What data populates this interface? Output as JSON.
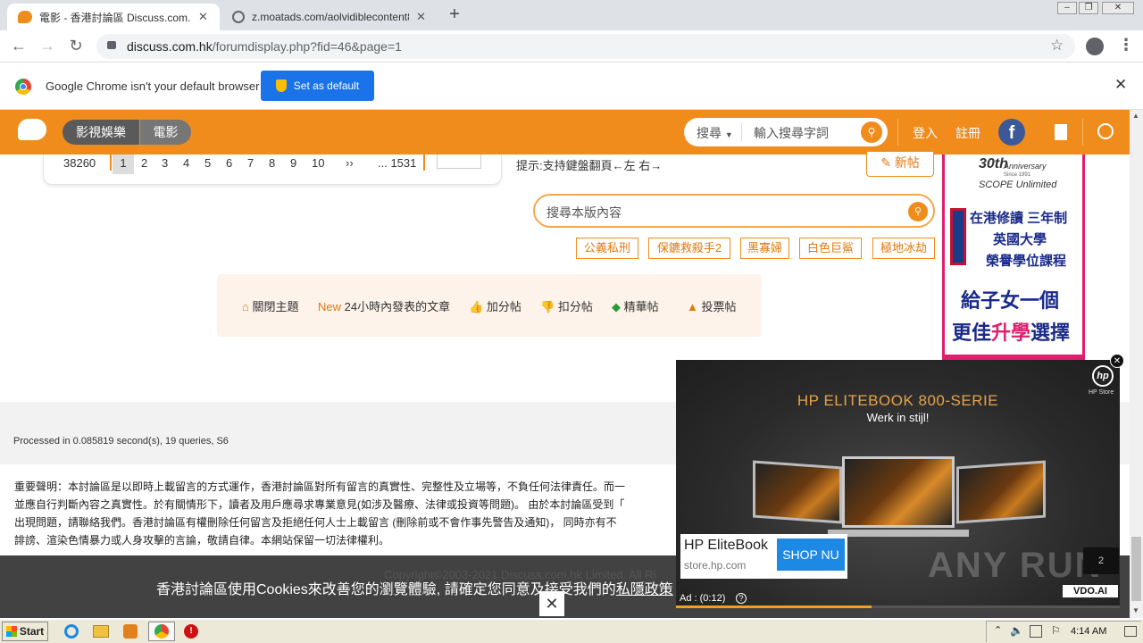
{
  "browser": {
    "tabs": [
      {
        "title": "電影 - 香港討論區 Discuss.com.hk -",
        "active": true
      },
      {
        "title": "z.moatads.com/aolvidiblecontent859",
        "active": false
      }
    ],
    "url_host": "discuss.com.hk",
    "url_path": "/forumdisplay.php?fid=46&page=1",
    "infobar_text": "Google Chrome isn't your default browser",
    "set_default_label": "Set as default"
  },
  "site": {
    "nav_tabs": [
      "影視娛樂",
      "電影"
    ],
    "search_scope": "搜尋",
    "search_placeholder": "輸入搜尋字詞",
    "login": "登入",
    "register": "註冊"
  },
  "pager": {
    "total": "38260",
    "pages": [
      "1",
      "2",
      "3",
      "4",
      "5",
      "6",
      "7",
      "8",
      "9",
      "10"
    ],
    "next": "››",
    "last": "... 1531",
    "current": "1"
  },
  "hint": "提示:支持鍵盤翻頁←左 右→",
  "new_post": "新帖",
  "board_search_placeholder": "搜尋本版內容",
  "tags": [
    "公義私刑",
    "保鑣救殺手2",
    "黑寡婦",
    "白色巨鯊",
    "極地冰劫"
  ],
  "actions": [
    {
      "label": "關閉主題",
      "prefix": ""
    },
    {
      "label": "24小時內發表的文章",
      "prefix": "New"
    },
    {
      "label": "加分帖",
      "prefix": ""
    },
    {
      "label": "扣分帖",
      "prefix": ""
    },
    {
      "label": "精華帖",
      "prefix": ""
    },
    {
      "label": "投票帖",
      "prefix": ""
    }
  ],
  "processed": "Processed in 0.085819 second(s), 19 queries, S6",
  "disclaimer": [
    "重要聲明：本討論區是以即時上載留言的方式運作，香港討論區對所有留言的真實性、完整性及立場等，不負任何法律責任。而一",
    "並應自行判斷內容之真實性。於有關情形下，讀者及用戶應尋求專業意見(如涉及醫療、法律或投資等問題)。 由於本討論區受到「",
    "出現問題，請聯絡我們。香港討論區有權刪除任何留言及拒絕任何人士上載留言 (刪除前或不會作事先警告及通知)， 同時亦有不",
    "誹謗、渲染色情暴力或人身攻擊的言論，敬請自律。本網站保留一切法律權利。"
  ],
  "copyright": "Copyright©2003-2021 Discuss.com.hk Limited. All Ri",
  "cookie": {
    "text": "香港討論區使用Cookies來改善您的瀏覽體驗, 請確定您同意及接受我們的",
    "link": "私隱政策",
    "close": "✕"
  },
  "side_ad": {
    "anniv": "30th",
    "anniv_word": "Anniversary",
    "since": "Since 1991",
    "brand": "SCOPE Unlimited",
    "line1": "在港修讀 三年制",
    "line2": "英國大學",
    "line3": "榮譽學位課程",
    "line4": "給子女一個",
    "line5a": "更佳",
    "line5b": "升學",
    "line5c": "選擇"
  },
  "video_ad": {
    "headline": "HP ELITEBOOK 800-SERIE",
    "tagline": "Werk in stijl!",
    "hp_store": "HP Store",
    "product": "HP EliteBook",
    "site": "store.hp.com",
    "cta": "SHOP NU",
    "timer": "Ad : (0:12)",
    "brand": "VDO.AI",
    "counter": "2",
    "watermark": "ANY RUN",
    "progress": 0.44
  },
  "taskbar": {
    "start": "Start",
    "time": "4:14 AM"
  }
}
